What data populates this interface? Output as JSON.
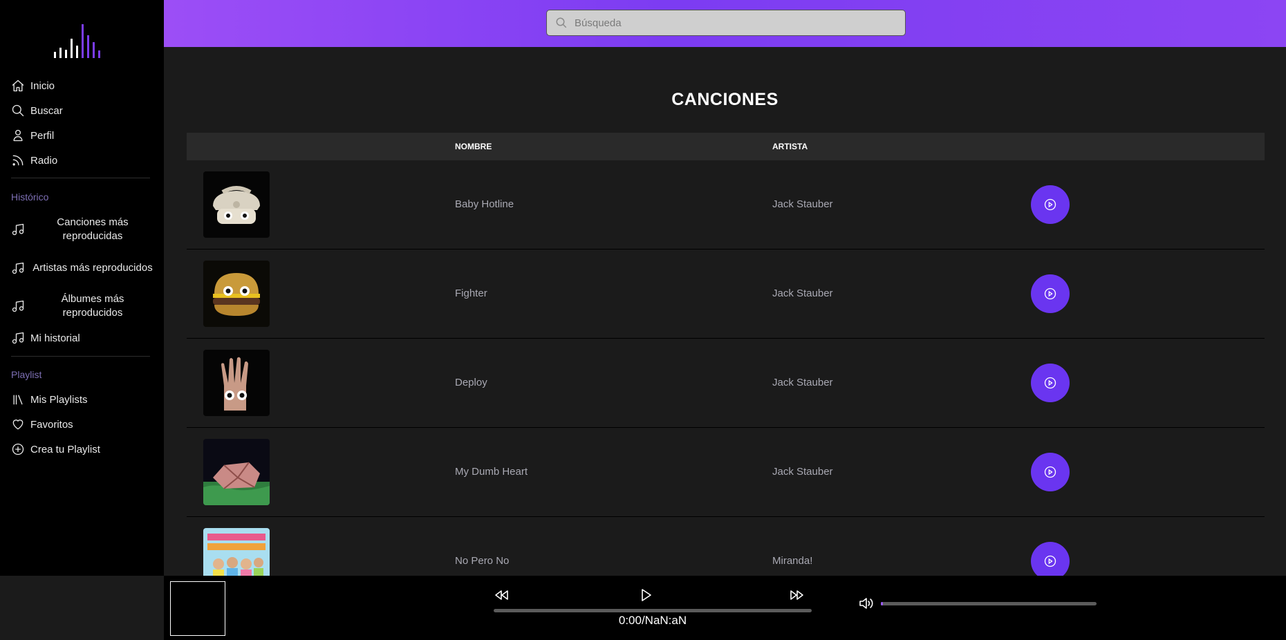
{
  "sidebar": {
    "nav": [
      {
        "label": "Inicio",
        "icon": "home-icon"
      },
      {
        "label": "Buscar",
        "icon": "search-icon"
      },
      {
        "label": "Perfil",
        "icon": "user-icon"
      },
      {
        "label": "Radio",
        "icon": "rss-icon"
      }
    ],
    "historico_title": "Histórico",
    "historico": [
      {
        "label": "Canciones más reproducidas",
        "icon": "music-note-icon"
      },
      {
        "label": "Artistas más reproducidos",
        "icon": "music-note-icon"
      },
      {
        "label": "Álbumes más reproducidos",
        "icon": "music-note-icon"
      },
      {
        "label": "Mi historial",
        "icon": "music-note-icon"
      }
    ],
    "playlist_title": "Playlist",
    "playlist": [
      {
        "label": "Mis Playlists",
        "icon": "library-icon"
      },
      {
        "label": "Favoritos",
        "icon": "heart-icon"
      },
      {
        "label": "Crea tu Playlist",
        "icon": "plus-circle-icon"
      }
    ]
  },
  "header": {
    "search_placeholder": "Búsqueda"
  },
  "main": {
    "title": "CANCIONES",
    "columns": {
      "name": "NOMBRE",
      "artist": "ARTISTA"
    },
    "songs": [
      {
        "name": "Baby Hotline",
        "artist": "Jack Stauber"
      },
      {
        "name": "Fighter",
        "artist": "Jack Stauber"
      },
      {
        "name": "Deploy",
        "artist": "Jack Stauber"
      },
      {
        "name": "My Dumb Heart",
        "artist": "Jack Stauber"
      },
      {
        "name": "No Pero No",
        "artist": "Miranda!"
      }
    ]
  },
  "player": {
    "time": "0:00/NaN:aN",
    "progress_fraction": 0,
    "volume_fraction": 0.01
  },
  "colors": {
    "accent": "#6a35f0",
    "header_gradient_start": "#9c4ef6",
    "header_gradient_end": "#8c45f3",
    "section_title": "#7d6fb4"
  }
}
